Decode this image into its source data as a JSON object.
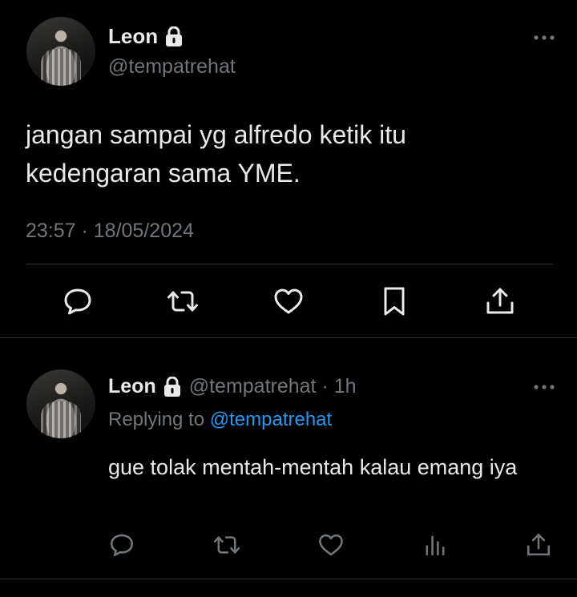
{
  "main_tweet": {
    "author_name": "Leon",
    "handle": "@tempatrehat",
    "text": "jangan sampai yg alfredo ketik itu kedengaran sama YME.",
    "timestamp": "23:57 · 18/05/2024"
  },
  "reply": {
    "author_name": "Leon",
    "handle_time": "@tempatrehat · 1h",
    "replying_prefix": "Replying to",
    "replying_mention": "@tempatrehat",
    "text": "gue tolak mentah-mentah kalau emang iya"
  },
  "icons": {
    "lock": "lock-icon",
    "more": "more-horizontal-icon",
    "reply": "speech-bubble-icon",
    "retweet": "retweet-icon",
    "like": "heart-icon",
    "bookmark": "bookmark-icon",
    "share": "share-upload-icon",
    "views": "bar-chart-icon"
  },
  "colors": {
    "background": "#000000",
    "text_primary": "#e7e9ea",
    "text_secondary": "#71767b",
    "accent_link": "#1d9bf0",
    "divider": "#2f3336"
  }
}
